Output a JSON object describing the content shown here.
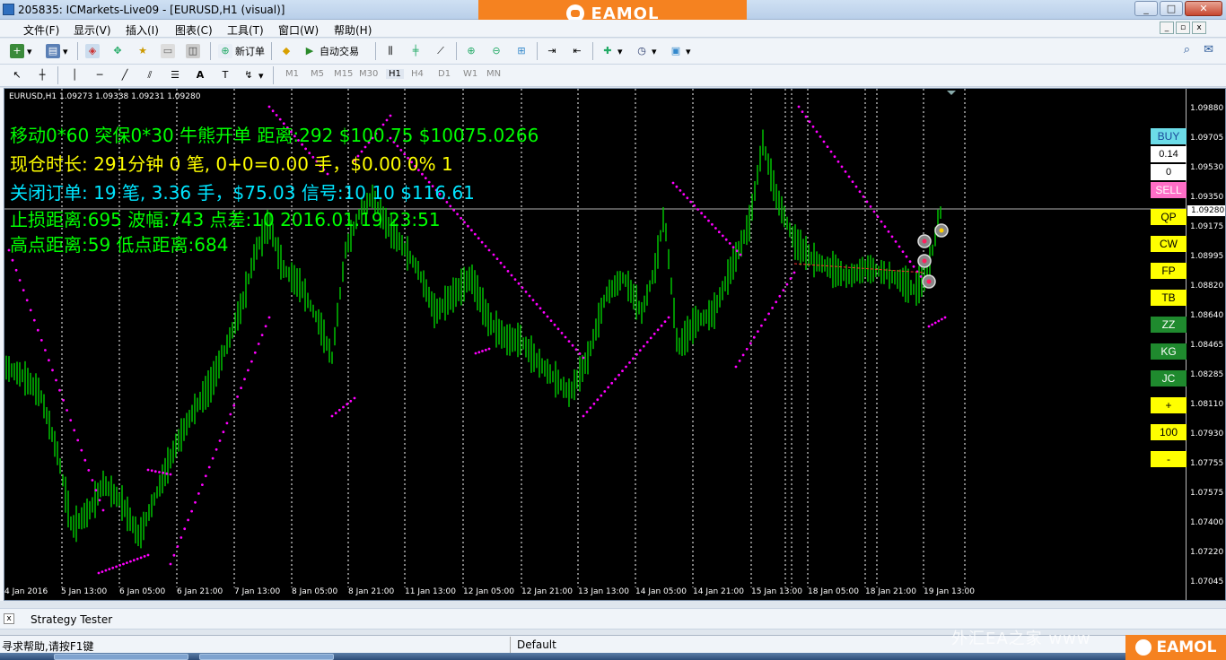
{
  "window": {
    "title": "205835: ICMarkets-Live09 - [EURUSD,H1 (visual)]",
    "minimize": "_",
    "restore": "□",
    "close": "✕"
  },
  "brand": {
    "name": "EAMOL",
    "color": "#f58220"
  },
  "menu": [
    "文件(F)",
    "显示(V)",
    "插入(I)",
    "图表(C)",
    "工具(T)",
    "窗口(W)",
    "帮助(H)"
  ],
  "toolbar": {
    "new_order": "新订单",
    "auto_trade": "自动交易",
    "timeframes": [
      "M1",
      "M5",
      "M15",
      "M30",
      "H1",
      "H4",
      "D1",
      "W1",
      "MN"
    ]
  },
  "chart": {
    "symbol_label": "EURUSD,H1  1.09273 1.09338 1.09231 1.09280",
    "overlay": {
      "line1": "移动0*60 突保0*30 牛熊开单 距离:292 $100.75 $10075.0266",
      "line2": "现仓时长: 291分钟 0 笔, 0+0=0.00 手，$0.00 0% 1",
      "line3": "关闭订单: 19 笔, 3.36 手，$75.03  信号:10 10 $116.61",
      "line4": "止损距离:695 波幅:743 点差:10  2016.01.19 23:51",
      "line5": "高点距离:59 低点距离:684"
    },
    "price_labels": [
      "1.09880",
      "1.09705",
      "1.09530",
      "1.09350",
      "1.09175",
      "1.08995",
      "1.08820",
      "1.08640",
      "1.08465",
      "1.08285",
      "1.08110",
      "1.07930",
      "1.07755",
      "1.07575",
      "1.07400",
      "1.07220",
      "1.07045"
    ],
    "current_price": "1.09280",
    "time_labels": [
      "4 Jan 2016",
      "5 Jan 13:00",
      "6 Jan 05:00",
      "6 Jan 21:00",
      "7 Jan 13:00",
      "8 Jan 05:00",
      "8 Jan 21:00",
      "11 Jan 13:00",
      "12 Jan 05:00",
      "12 Jan 21:00",
      "13 Jan 13:00",
      "14 Jan 05:00",
      "14 Jan 21:00",
      "15 Jan 13:00",
      "18 Jan 05:00",
      "18 Jan 21:00",
      "19 Jan 13:00"
    ],
    "colors": {
      "candle": "#00c000",
      "sar": "#ff00ff",
      "line_green": "#00ff00",
      "line_yellow": "#ffff00",
      "line_cyan": "#00e5ff"
    }
  },
  "side_buttons": {
    "buy": "BUY",
    "lot": "0.14",
    "zero": "0",
    "sell": "SELL",
    "qp": "QP",
    "cw": "CW",
    "fp": "FP",
    "tb": "TB",
    "zz": "ZZ",
    "kg": "KG",
    "jc": "JC",
    "plus": "+",
    "hundred": "100",
    "minus": "-"
  },
  "strategy_tester": {
    "label": "Strategy Tester"
  },
  "status": {
    "help": "寻求帮助,请按F1键",
    "profile": "Default"
  },
  "watermark": "外汇EA之家 www"
}
